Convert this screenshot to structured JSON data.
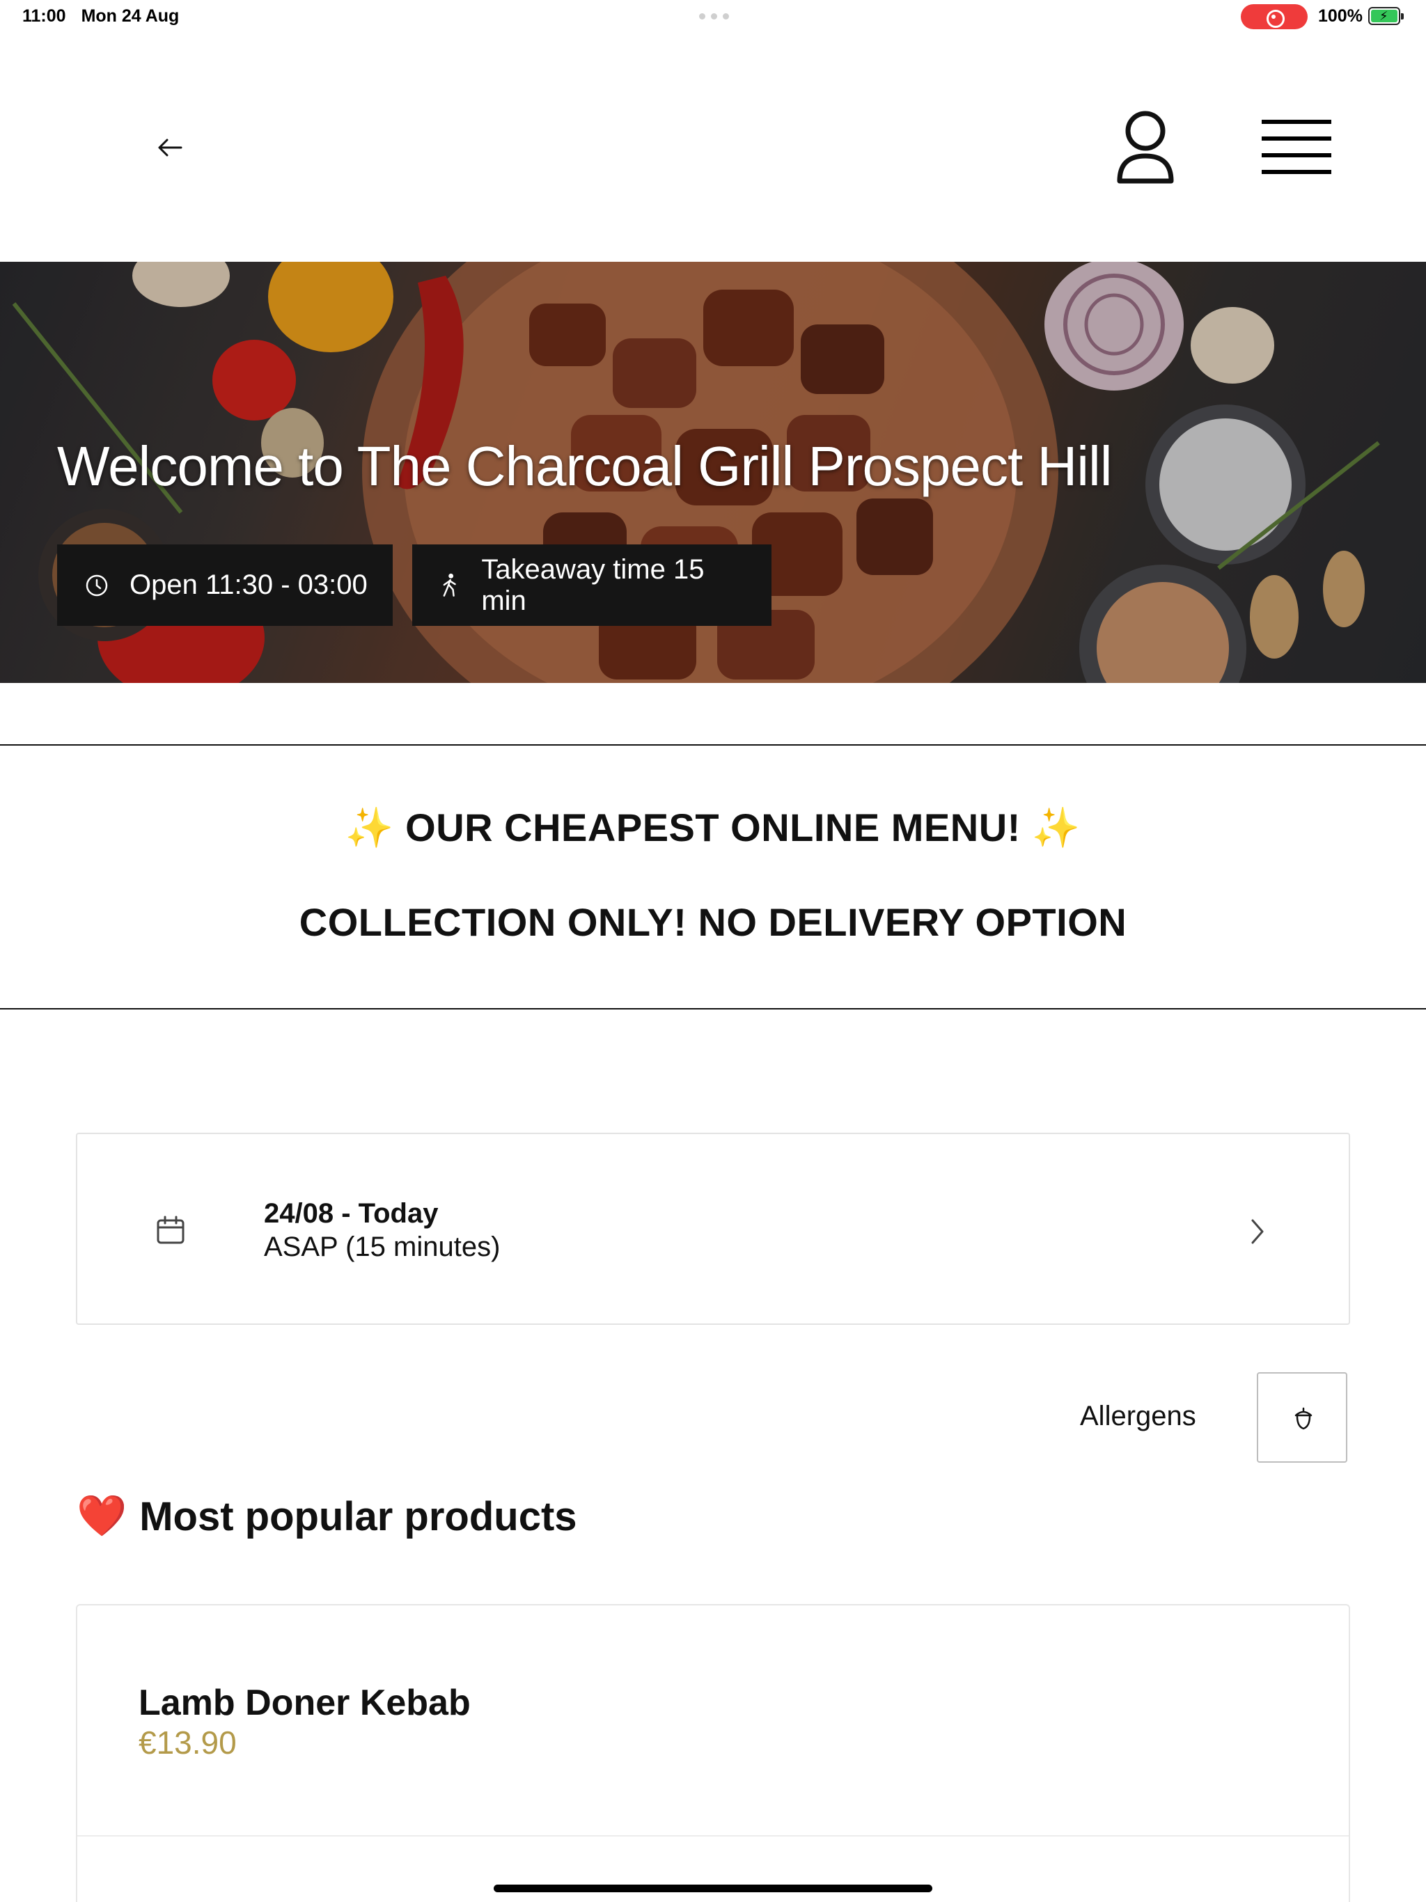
{
  "status_bar": {
    "time": "11:00",
    "date": "Mon 24 Aug",
    "battery": "100%"
  },
  "nav": {
    "back_icon": "arrow-left-icon",
    "profile_icon": "user-icon",
    "menu_icon": "hamburger-menu-icon"
  },
  "hero": {
    "title": "Welcome to The Charcoal Grill Prospect Hill",
    "open_hours": "Open 11:30 - 03:00",
    "takeaway_time": "Takeaway time 15 min"
  },
  "banner": {
    "line1_text": "OUR CHEAPEST ONLINE MENU!",
    "sparkle": "✨",
    "line2": "COLLECTION ONLY! NO DELIVERY OPTION"
  },
  "date_selector": {
    "title": "24/08 - Today",
    "subtitle": "ASAP (15 minutes)"
  },
  "allergens": {
    "label": "Allergens"
  },
  "popular": {
    "emoji": "❤️",
    "title": "Most popular products",
    "products": [
      {
        "name": "Lamb Doner Kebab",
        "price": "€13.90"
      }
    ]
  },
  "colors": {
    "accent_price": "#b39a4a",
    "chip_bg": "#151515",
    "record_red": "#ef3b3b",
    "battery_green": "#34c759"
  }
}
